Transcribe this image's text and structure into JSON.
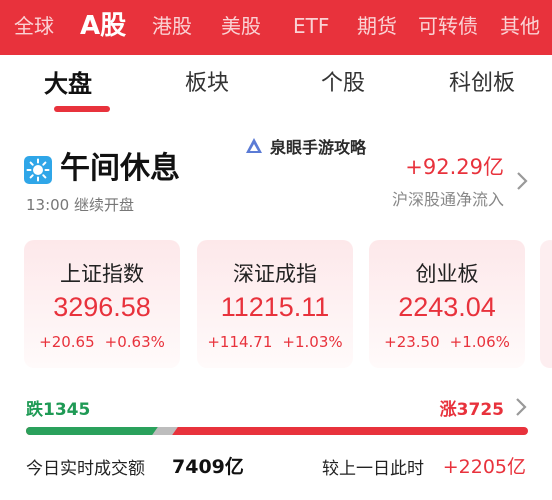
{
  "market_tabs": [
    {
      "label": "全球"
    },
    {
      "label": "A股",
      "active": true
    },
    {
      "label": "港股"
    },
    {
      "label": "美股"
    },
    {
      "label": "ETF"
    },
    {
      "label": "期货"
    },
    {
      "label": "可转债"
    },
    {
      "label": "其他"
    }
  ],
  "sub_tabs": [
    {
      "label": "大盘",
      "active": true
    },
    {
      "label": "板块"
    },
    {
      "label": "个股"
    },
    {
      "label": "科创板"
    }
  ],
  "watermark": {
    "text": "泉眼手游攻略"
  },
  "session": {
    "icon": "sun-icon",
    "title": "午间休息",
    "subtitle": "13:00 继续开盘"
  },
  "northbound": {
    "value": "+92.29亿",
    "label": "沪深股通净流入"
  },
  "indices": [
    {
      "name": "上证指数",
      "price": "3296.58",
      "change": "+20.65",
      "pct": "+0.63%"
    },
    {
      "name": "深证成指",
      "price": "11215.11",
      "change": "+114.71",
      "pct": "+1.03%"
    },
    {
      "name": "创业板",
      "price": "2243.04",
      "change": "+23.50",
      "pct": "+1.06%"
    }
  ],
  "breadth": {
    "down_label": "跌1345",
    "up_label": "涨3725",
    "down_count": 1345,
    "up_count": 3725
  },
  "turnover": {
    "label": "今日实时成交额",
    "value": "7409亿",
    "compare_label": "较上一日此时",
    "compare_value": "+2205亿"
  },
  "colors": {
    "brand_red": "#e8323c",
    "down_green": "#2aa15c",
    "sun_blue": "#2fa6e8"
  }
}
